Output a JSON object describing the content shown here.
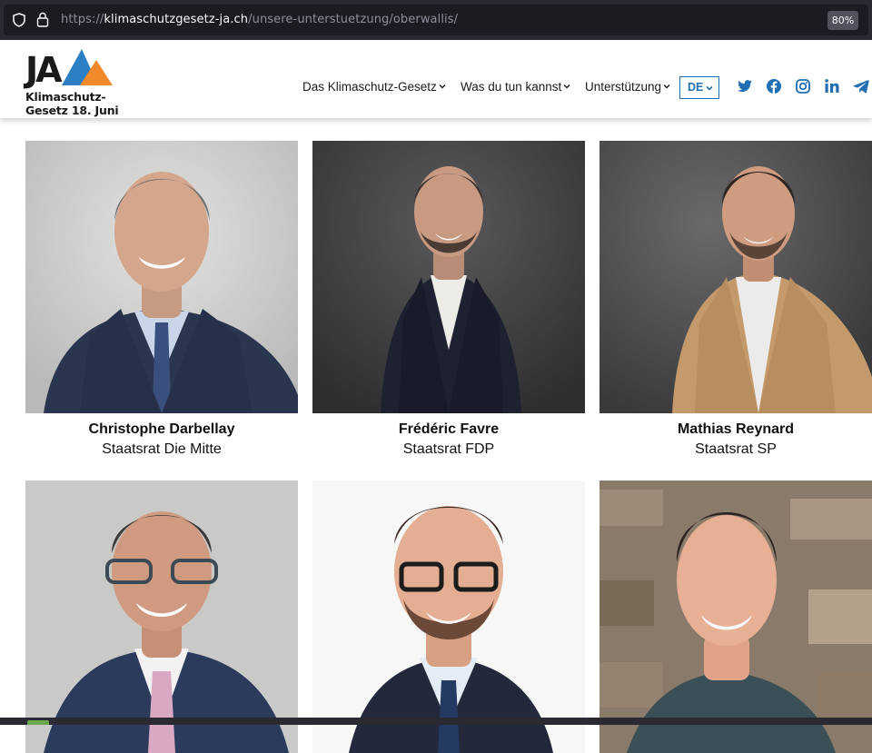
{
  "browser": {
    "url_scheme": "https://",
    "url_host": "klimaschutzgesetz-ja.ch",
    "url_path": "/unsere-unterstuetzung/oberwallis/",
    "zoom": "80%"
  },
  "logo": {
    "ja": "JA",
    "line1": "Klimaschutz-",
    "line2": "Gesetz 18. Juni"
  },
  "nav": {
    "items": [
      {
        "label": "Das Klimaschutz-Gesetz"
      },
      {
        "label": "Was du tun kannst"
      },
      {
        "label": "Unterstützung"
      }
    ],
    "language": "DE",
    "social": [
      "twitter-icon",
      "facebook-icon",
      "instagram-icon",
      "linkedin-icon",
      "telegram-icon"
    ]
  },
  "colors": {
    "accent_blue": "#1f6fb2",
    "logo_blue": "#2d7fc4",
    "logo_orange": "#f08a2a"
  },
  "people": [
    {
      "name": "Christophe Darbellay",
      "role": "Staatsrat Die Mitte"
    },
    {
      "name": "Frédéric Favre",
      "role": "Staatsrat FDP"
    },
    {
      "name": "Mathias Reynard",
      "role": "Staatsrat SP"
    },
    {
      "name": "",
      "role": ""
    },
    {
      "name": "",
      "role": ""
    },
    {
      "name": "",
      "role": ""
    }
  ]
}
